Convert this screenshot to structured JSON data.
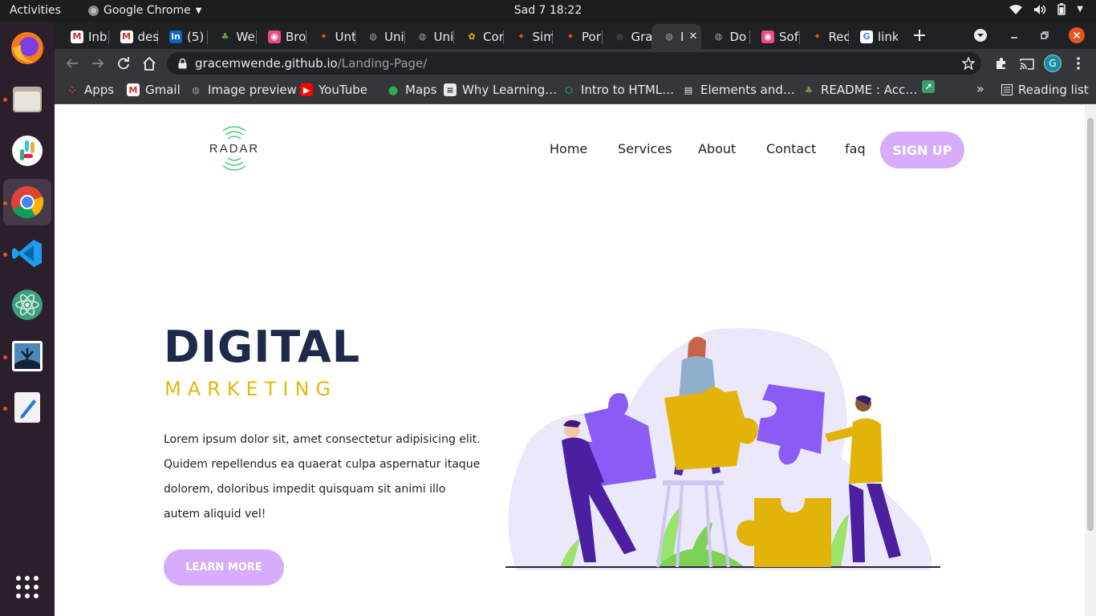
{
  "system": {
    "activities": "Activities",
    "app_name": "Google Chrome",
    "clock": "Sad 7  18:22"
  },
  "tabs": [
    {
      "title": "Inb",
      "icon": "gmail-icon"
    },
    {
      "title": "des",
      "icon": "gmail-icon"
    },
    {
      "title": "(5)",
      "icon": "linkedin-icon"
    },
    {
      "title": "We",
      "icon": "tree-icon"
    },
    {
      "title": "Bro",
      "icon": "dribbble-icon"
    },
    {
      "title": "Unt",
      "icon": "figma-icon"
    },
    {
      "title": "Uni",
      "icon": "globe-icon"
    },
    {
      "title": "Uni",
      "icon": "globe-icon"
    },
    {
      "title": "Cor",
      "icon": "coolors-icon"
    },
    {
      "title": "Sim",
      "icon": "figma-icon"
    },
    {
      "title": "Por",
      "icon": "figma-icon"
    },
    {
      "title": "Gra",
      "icon": "github-icon"
    },
    {
      "title": "I",
      "icon": "globe-icon",
      "active": true
    },
    {
      "title": "Do",
      "icon": "globe-icon"
    },
    {
      "title": "Sof",
      "icon": "dribbble-icon"
    },
    {
      "title": "Rec",
      "icon": "figma-icon"
    },
    {
      "title": "link",
      "icon": "google-icon"
    }
  ],
  "address": {
    "host": "gracemwende.github.io",
    "path": "/Landing-Page/"
  },
  "profile_initial": "G",
  "bookmarks": [
    {
      "label": "Apps",
      "icon": "apps-grid-icon"
    },
    {
      "label": "Gmail",
      "icon": "gmail-icon"
    },
    {
      "label": "Image preview",
      "icon": "globe-icon"
    },
    {
      "label": "YouTube",
      "icon": "youtube-icon"
    },
    {
      "label": "Maps",
      "icon": "maps-icon"
    },
    {
      "label": "Why Learning…",
      "icon": "notes-icon"
    },
    {
      "label": "Intro to HTML…",
      "icon": "hex-icon"
    },
    {
      "label": "Elements and…",
      "icon": "doc-icon"
    },
    {
      "label": "README : Acc…",
      "icon": "tree-icon"
    }
  ],
  "reading_list": "Reading list",
  "site": {
    "logo_text": "RADAR",
    "nav": [
      "Home",
      "Services",
      "About",
      "Contact",
      "faq"
    ],
    "signup": "SIGN UP",
    "hero_title": "DIGITAL",
    "hero_subtitle": "MARKETING",
    "hero_text": "Lorem ipsum dolor sit, amet consectetur adipisicing elit. Quidem repellendus ea quaerat culpa aspernatur itaque dolorem, doloribus impedit quisquam sit animi illo autem aliquid vel!",
    "learn_more": "LEARN MORE"
  },
  "colors": {
    "accent": "#d7acfb",
    "title": "#1f2a4a",
    "subtitle": "#e5b80b",
    "puzzle_purple": "#8a5cf5",
    "puzzle_yellow": "#e2b40a"
  }
}
